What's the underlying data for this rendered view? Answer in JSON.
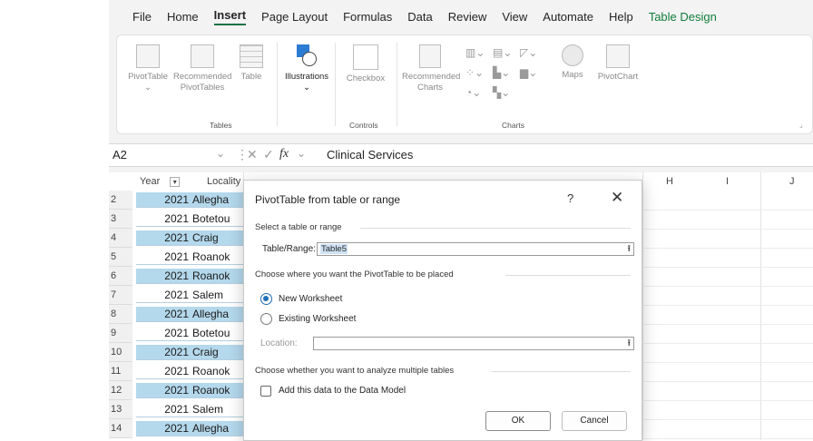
{
  "menu": {
    "items": [
      "File",
      "Home",
      "Insert",
      "Page Layout",
      "Formulas",
      "Data",
      "Review",
      "View",
      "Automate",
      "Help",
      "Table Design"
    ],
    "active": "Insert",
    "accent_item": "Table Design"
  },
  "ribbon": {
    "pivottable": "PivotTable",
    "recommended_pivot_1": "Recommended",
    "recommended_pivot_2": "PivotTables",
    "table": "Table",
    "illustrations": "Illustrations",
    "checkbox": "Checkbox",
    "recommended_charts_1": "Recommended",
    "recommended_charts_2": "Charts",
    "maps": "Maps",
    "pivotchart": "PivotChart",
    "group_tables": "Tables",
    "group_controls": "Controls",
    "group_charts": "Charts"
  },
  "formula_bar": {
    "name_box": "A2",
    "fx": "fx",
    "value": "Clinical Services"
  },
  "sheet": {
    "column_headers": [
      "Year",
      "Locality",
      "H",
      "I",
      "J"
    ],
    "rows": [
      {
        "num": "2",
        "year": "2021",
        "locality": "Allegha"
      },
      {
        "num": "3",
        "year": "2021",
        "locality": "Botetou"
      },
      {
        "num": "4",
        "year": "2021",
        "locality": "Craig"
      },
      {
        "num": "5",
        "year": "2021",
        "locality": "Roanok"
      },
      {
        "num": "6",
        "year": "2021",
        "locality": "Roanok"
      },
      {
        "num": "7",
        "year": "2021",
        "locality": "Salem"
      },
      {
        "num": "8",
        "year": "2021",
        "locality": "Allegha"
      },
      {
        "num": "9",
        "year": "2021",
        "locality": "Botetou"
      },
      {
        "num": "10",
        "year": "2021",
        "locality": "Craig"
      },
      {
        "num": "11",
        "year": "2021",
        "locality": "Roanok"
      },
      {
        "num": "12",
        "year": "2021",
        "locality": "Roanok"
      },
      {
        "num": "13",
        "year": "2021",
        "locality": "Salem"
      },
      {
        "num": "14",
        "year": "2021",
        "locality": "Allegha"
      }
    ]
  },
  "dialog": {
    "title": "PivotTable from table or range",
    "help": "?",
    "close": "✕",
    "section_select": "Select a table or range",
    "table_range_label": "Table/Range:",
    "table_range_value": "Table5",
    "section_place": "Choose where you want the PivotTable to be placed",
    "new_worksheet": "New Worksheet",
    "existing_worksheet": "Existing Worksheet",
    "location_label": "Location:",
    "location_value": "",
    "section_multiple": "Choose whether you want to analyze multiple tables",
    "data_model": "Add this data to the Data Model",
    "ok": "OK",
    "cancel": "Cancel"
  },
  "colors": {
    "accent_green": "#117e3c",
    "row_highlight": "#b4d8ec",
    "radio_blue": "#1f6fb8"
  }
}
